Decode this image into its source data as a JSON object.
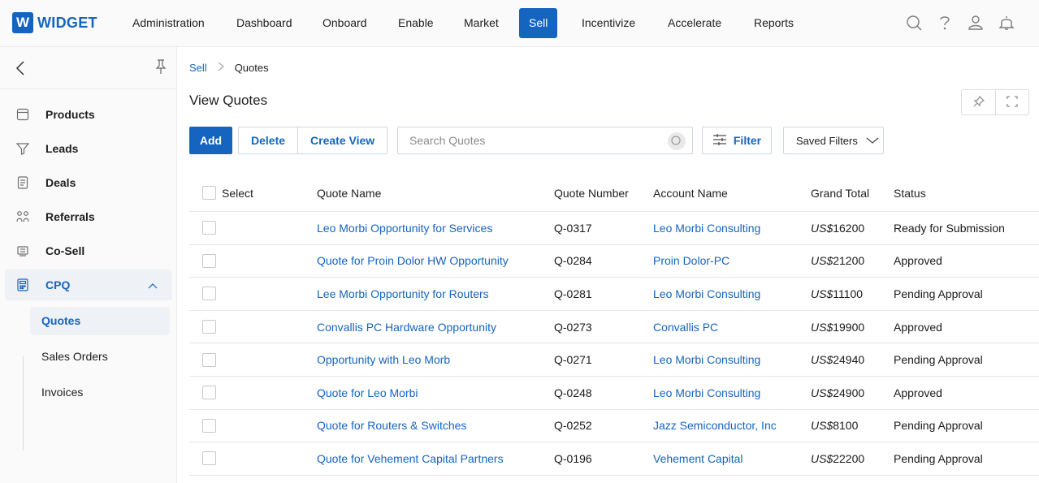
{
  "brand": {
    "logo_letter": "W",
    "name": "WIDGET",
    "color": "#1565c0"
  },
  "nav": {
    "items": [
      {
        "label": "Administration",
        "active": false
      },
      {
        "label": "Dashboard",
        "active": false
      },
      {
        "label": "Onboard",
        "active": false
      },
      {
        "label": "Enable",
        "active": false
      },
      {
        "label": "Market",
        "active": false
      },
      {
        "label": "Sell",
        "active": true
      },
      {
        "label": "Incentivize",
        "active": false
      },
      {
        "label": "Accelerate",
        "active": false
      },
      {
        "label": "Reports",
        "active": false
      }
    ],
    "icons": [
      "search-icon",
      "help-icon",
      "user-icon",
      "notification-bell-icon"
    ]
  },
  "sidebar": {
    "items": [
      {
        "label": "Products",
        "icon": "products-icon"
      },
      {
        "label": "Leads",
        "icon": "leads-funnel-icon"
      },
      {
        "label": "Deals",
        "icon": "deals-icon"
      },
      {
        "label": "Referrals",
        "icon": "referrals-icon"
      },
      {
        "label": "Co-Sell",
        "icon": "co-sell-icon"
      },
      {
        "label": "CPQ",
        "icon": "cpq-icon",
        "expanded": true
      }
    ],
    "sub_items": [
      {
        "label": "Quotes",
        "active": true
      },
      {
        "label": "Sales Orders",
        "active": false
      },
      {
        "label": "Invoices",
        "active": false
      }
    ]
  },
  "breadcrumb": {
    "parent": "Sell",
    "current": "Quotes"
  },
  "page_title": "View Quotes",
  "toolbar": {
    "add_label": "Add",
    "delete_label": "Delete",
    "create_view_label": "Create View",
    "search_placeholder": "Search Quotes",
    "filter_label": "Filter",
    "saved_filters_label": "Saved Filters"
  },
  "table": {
    "headers": {
      "select": "Select",
      "name": "Quote Name",
      "number": "Quote Number",
      "account": "Account Name",
      "total": "Grand Total",
      "status": "Status"
    },
    "rows": [
      {
        "name": "Leo Morbi Opportunity for Services",
        "number": "Q-0317",
        "account": "Leo Morbi Consulting",
        "currency": "US$",
        "amount": "16200",
        "status": "Ready for Submission"
      },
      {
        "name": "Quote for Proin Dolor HW Opportunity",
        "number": "Q-0284",
        "account": "Proin Dolor-PC",
        "currency": "US$",
        "amount": "21200",
        "status": "Approved"
      },
      {
        "name": "Lee Morbi Opportunity for Routers",
        "number": "Q-0281",
        "account": "Leo Morbi Consulting",
        "currency": "US$",
        "amount": "11100",
        "status": "Pending Approval"
      },
      {
        "name": "Convallis PC Hardware Opportunity",
        "number": "Q-0273",
        "account": "Convallis PC",
        "currency": "US$",
        "amount": "19900",
        "status": "Approved"
      },
      {
        "name": "Opportunity with Leo Morb",
        "number": "Q-0271",
        "account": "Leo Morbi Consulting",
        "currency": "US$",
        "amount": "24940",
        "status": "Pending Approval"
      },
      {
        "name": "Quote for Leo Morbi",
        "number": "Q-0248",
        "account": "Leo Morbi Consulting",
        "currency": "US$",
        "amount": "24900",
        "status": "Approved"
      },
      {
        "name": "Quote for Routers & Switches",
        "number": "Q-0252",
        "account": "Jazz Semiconductor, Inc",
        "currency": "US$",
        "amount": "8100",
        "status": "Pending Approval"
      },
      {
        "name": "Quote for Vehement Capital Partners",
        "number": "Q-0196",
        "account": "Vehement Capital",
        "currency": "US$",
        "amount": "22200",
        "status": "Pending Approval"
      }
    ]
  }
}
